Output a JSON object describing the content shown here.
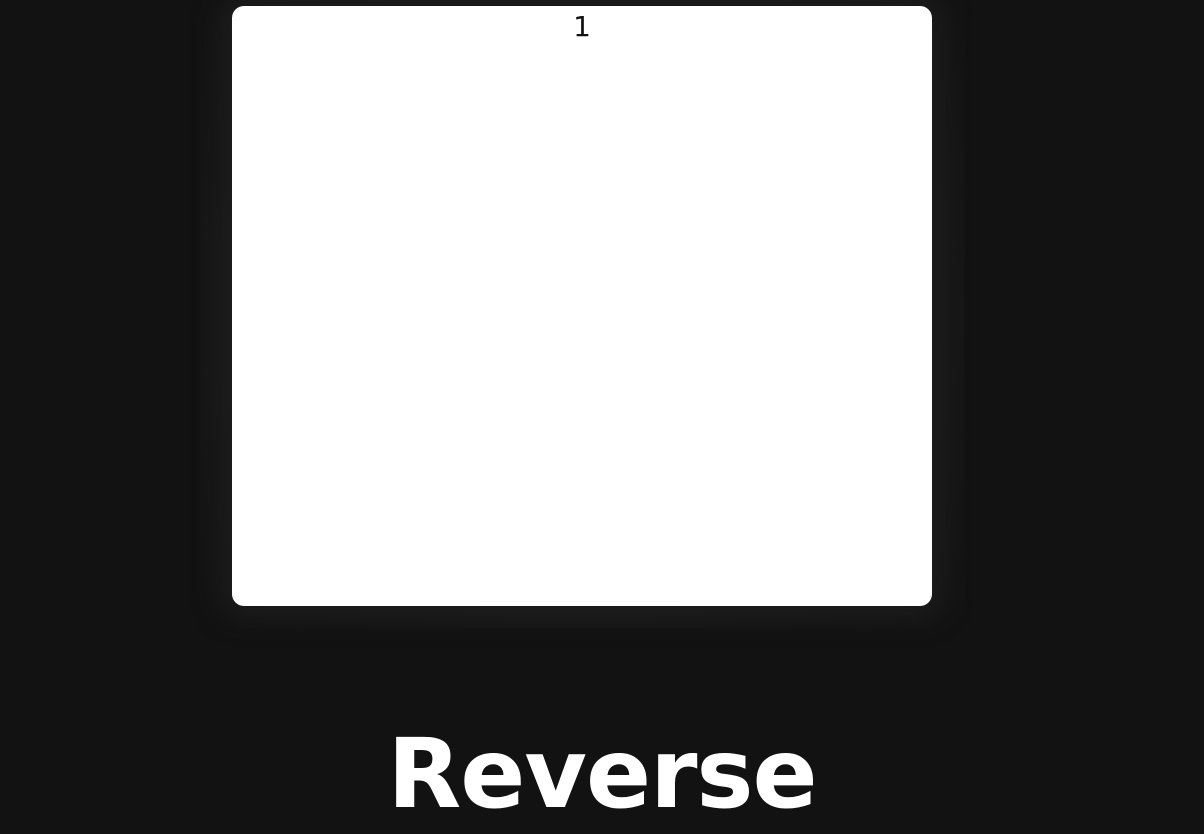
{
  "card": {
    "number": "1"
  },
  "action": {
    "label": "Reverse"
  },
  "colors": {
    "background": "#121212",
    "card": "#ffffff",
    "card_text": "#111111",
    "label_text": "#ffffff"
  }
}
